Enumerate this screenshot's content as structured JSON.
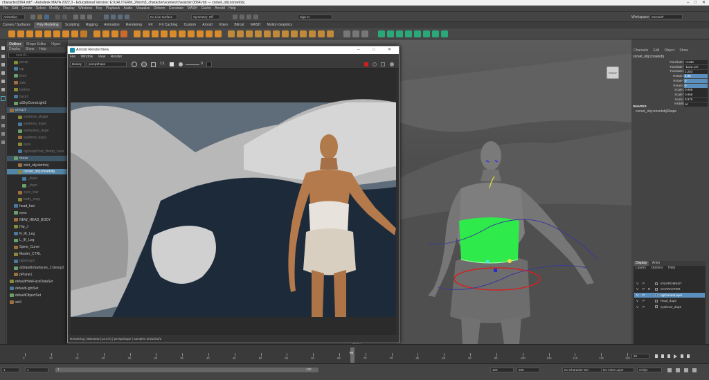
{
  "window": {
    "title": "character2064.mb* - Autodesk MAYA 2022.3 - Educational Version: E:\\UAL\\TERM_2\\term3_character\\scenes\\character.0064.mb  ---  corset_obj:corsetobj"
  },
  "menubar": [
    "File",
    "Edit",
    "Create",
    "Select",
    "Modify",
    "Display",
    "Windows",
    "Key",
    "Playback",
    "Audio",
    "Visualize",
    "Deform",
    "Constrain",
    "MASH",
    "Cache",
    "Arnold",
    "Help"
  ],
  "statusline": {
    "mode": "Animation",
    "no_live_surface": "No Live Surface",
    "symmetry": "Symmetry: Off",
    "sign_in": "Sign In",
    "workspace_label": "Workspace:",
    "workspace": "General*"
  },
  "shelf_tabs": [
    "Curves / Surfaces",
    "Poly Modeling",
    "Sculpting",
    "Rigging",
    "Animation",
    "Rendering",
    "FX",
    "FX Caching",
    "Custom",
    "Arnold",
    "XGen",
    "Bifrost",
    "MASH",
    "Motion Graphics"
  ],
  "shelf_active": "Poly Modeling",
  "outliner": {
    "tabs": [
      "Outliner",
      "Shape Editor",
      "Hyper"
    ],
    "menu": [
      "Display",
      "Show",
      "Help"
    ],
    "search_placeholder": "search...",
    "rows": [
      {
        "label": "persp",
        "cls": "dim",
        "indent": 1
      },
      {
        "label": "top",
        "cls": "dim",
        "indent": 1
      },
      {
        "label": "front",
        "cls": "dim",
        "indent": 1
      },
      {
        "label": "side",
        "cls": "dim",
        "indent": 1
      },
      {
        "label": "bottom",
        "cls": "dim",
        "indent": 1
      },
      {
        "label": "back1",
        "cls": "dim",
        "indent": 1
      },
      {
        "label": "aiSkyDomeLight1",
        "cls": "",
        "indent": 1
      },
      {
        "label": "group1",
        "cls": "hl",
        "indent": 0
      },
      {
        "label": "eyebrow_shape",
        "cls": "dim",
        "indent": 2
      },
      {
        "label": "eyebrow_dupe",
        "cls": "dim",
        "indent": 2
      },
      {
        "label": "eyelashes_dupe",
        "cls": "dim",
        "indent": 2
      },
      {
        "label": "eyebrow_dupe",
        "cls": "dim",
        "indent": 2
      },
      {
        "label": "eyes",
        "cls": "dim",
        "indent": 2
      },
      {
        "label": "ogSculptTool_Hemp_Lace",
        "cls": "dim",
        "indent": 2
      },
      {
        "label": "dress",
        "cls": "hl",
        "indent": 1
      },
      {
        "label": "skirt_obj:skirtobj",
        "cls": "",
        "indent": 2
      },
      {
        "label": "corset_obj:corsetobj",
        "cls": "sel",
        "indent": 2
      },
      {
        "label": "_dupe",
        "cls": "dim",
        "indent": 3
      },
      {
        "label": "_dupe",
        "cls": "dim",
        "indent": 3
      },
      {
        "label": "eyes_hair",
        "cls": "dim",
        "indent": 2
      },
      {
        "label": "body_copy",
        "cls": "dim",
        "indent": 2
      },
      {
        "label": "head_hair",
        "cls": "",
        "indent": 1
      },
      {
        "label": "eyes",
        "cls": "",
        "indent": 1
      },
      {
        "label": "NEW_HEAD_BODY",
        "cls": "",
        "indent": 1
      },
      {
        "label": "Hip_J",
        "cls": "",
        "indent": 1
      },
      {
        "label": "R_IK_Leg",
        "cls": "",
        "indent": 1
      },
      {
        "label": "L_IK_Leg",
        "cls": "",
        "indent": 1
      },
      {
        "label": "Spine_Curve",
        "cls": "",
        "indent": 1
      },
      {
        "label": "Master_CTRL",
        "cls": "",
        "indent": 1
      },
      {
        "label": "bgGroup1",
        "cls": "dim",
        "indent": 1
      },
      {
        "label": "aiStandInSurfaces_1:Group2",
        "cls": "",
        "indent": 1
      },
      {
        "label": "pPlane1",
        "cls": "",
        "indent": 1
      },
      {
        "label": "defaultHideFaceDataSet",
        "cls": "",
        "indent": 0
      },
      {
        "label": "defaultLightSet",
        "cls": "",
        "indent": 0
      },
      {
        "label": "defaultObjectSet",
        "cls": "",
        "indent": 0
      },
      {
        "label": "set1",
        "cls": "",
        "indent": 0
      }
    ]
  },
  "render_view": {
    "title": "Arnold RenderView",
    "menu": [
      "File",
      "Window",
      "View",
      "Render"
    ],
    "aov": "Beauty",
    "camera": "perspShape",
    "ratio": "1:1",
    "exposure": "0",
    "status": "Rendering | 960x540 (14:1%) | perspShape | samples 3/4/2/2/2/2"
  },
  "viewport": {
    "camera_label": "persp",
    "cube_label": "FRONT"
  },
  "channel_box": {
    "tabs": [
      "Channels",
      "Edit",
      "Object",
      "Show"
    ],
    "object": "corset_obj:corsetobj",
    "attrs": [
      {
        "name": "Translate X",
        "value": "-4.236",
        "active": false
      },
      {
        "name": "Translate Y",
        "value": "-1122.147",
        "active": false
      },
      {
        "name": "Translate Z",
        "value": "2.203",
        "active": false
      },
      {
        "name": "Rotate X",
        "value": "4.65",
        "active": true
      },
      {
        "name": "Rotate Y",
        "value": "0",
        "active": true
      },
      {
        "name": "Rotate Z",
        "value": "0",
        "active": true
      },
      {
        "name": "Scale X",
        "value": "0.968",
        "active": false
      },
      {
        "name": "Scale Y",
        "value": "0.968",
        "active": false
      },
      {
        "name": "Scale Z",
        "value": "0.976",
        "active": false
      },
      {
        "name": "Visibility",
        "value": "on",
        "active": false
      }
    ],
    "shapes_title": "SHAPES",
    "shape_name": "corset_obj:corsetobjShape"
  },
  "layers": {
    "tabs": [
      "Display",
      "Anim"
    ],
    "menu": [
      "Layers",
      "Options",
      "Help"
    ],
    "rows": [
      {
        "v": "V",
        "p": "P",
        "r": "",
        "name": "ENVIROMENT",
        "color": "#333",
        "sel": false
      },
      {
        "v": "V",
        "p": "P",
        "r": "R",
        "name": "CHARACTER",
        "color": "#333",
        "sel": false
      },
      {
        "v": "V",
        "p": "P",
        "r": "",
        "name": "ogCurvesLayer",
        "color": "#3a6ea5",
        "sel": true
      },
      {
        "v": "V",
        "p": "P",
        "r": "",
        "name": "head_dupe",
        "color": "#333",
        "sel": false
      },
      {
        "v": "V",
        "p": "P",
        "r": "",
        "name": "eyebrow_dupe",
        "color": "#333",
        "sel": false
      }
    ]
  },
  "timeline": {
    "ticks": [
      "5",
      "10",
      "15",
      "20",
      "25",
      "30",
      "35",
      "40",
      "45",
      "50",
      "55",
      "60",
      "65",
      "70",
      "75",
      "80",
      "85",
      "90",
      "95",
      "100",
      "105",
      "110",
      "115",
      "120"
    ],
    "current_frame": "66",
    "range_start": "1",
    "range_inner_start": "1",
    "range_inner_end": "120",
    "range_end": "120",
    "anim_end": "200",
    "character_set": "No Character Set",
    "anim_layer": "No Anim Layer",
    "fps": "24 fps"
  }
}
